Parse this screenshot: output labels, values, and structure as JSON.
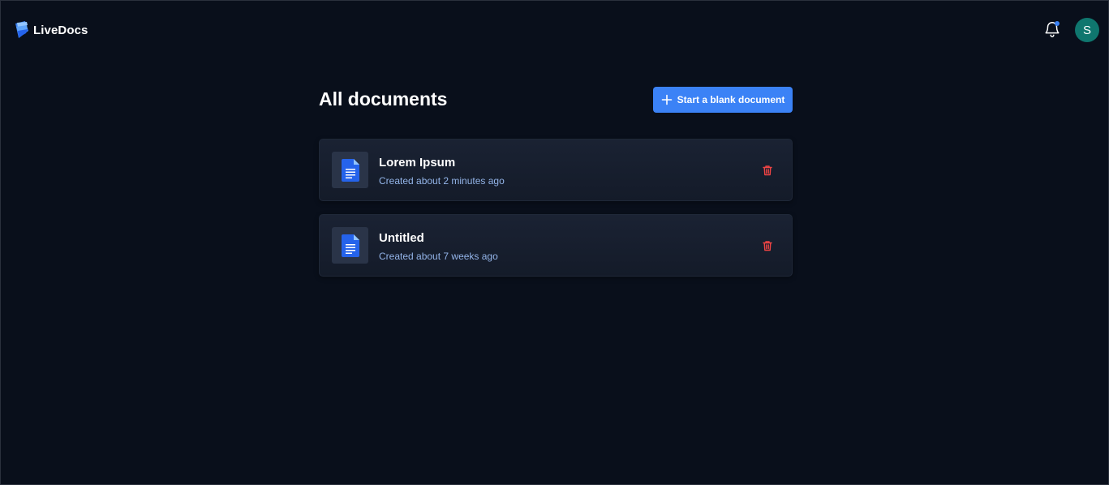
{
  "app": {
    "name": "LiveDocs",
    "logo_icon": "livedocs-logo-icon"
  },
  "header": {
    "notifications_icon": "bell-icon",
    "has_unread": true,
    "avatar_initial": "S",
    "avatar_color": "#0f766e"
  },
  "main": {
    "title": "All documents",
    "new_button_label": "Start a blank document",
    "new_button_icon": "plus-icon"
  },
  "documents": [
    {
      "title": "Lorem Ipsum",
      "created": "Created about 2 minutes ago"
    },
    {
      "title": "Untitled",
      "created": "Created about 7 weeks ago"
    }
  ],
  "colors": {
    "background": "#090f1b",
    "accent": "#3b82f6",
    "delete": "#ef4444",
    "meta_text": "#93b4e8"
  }
}
